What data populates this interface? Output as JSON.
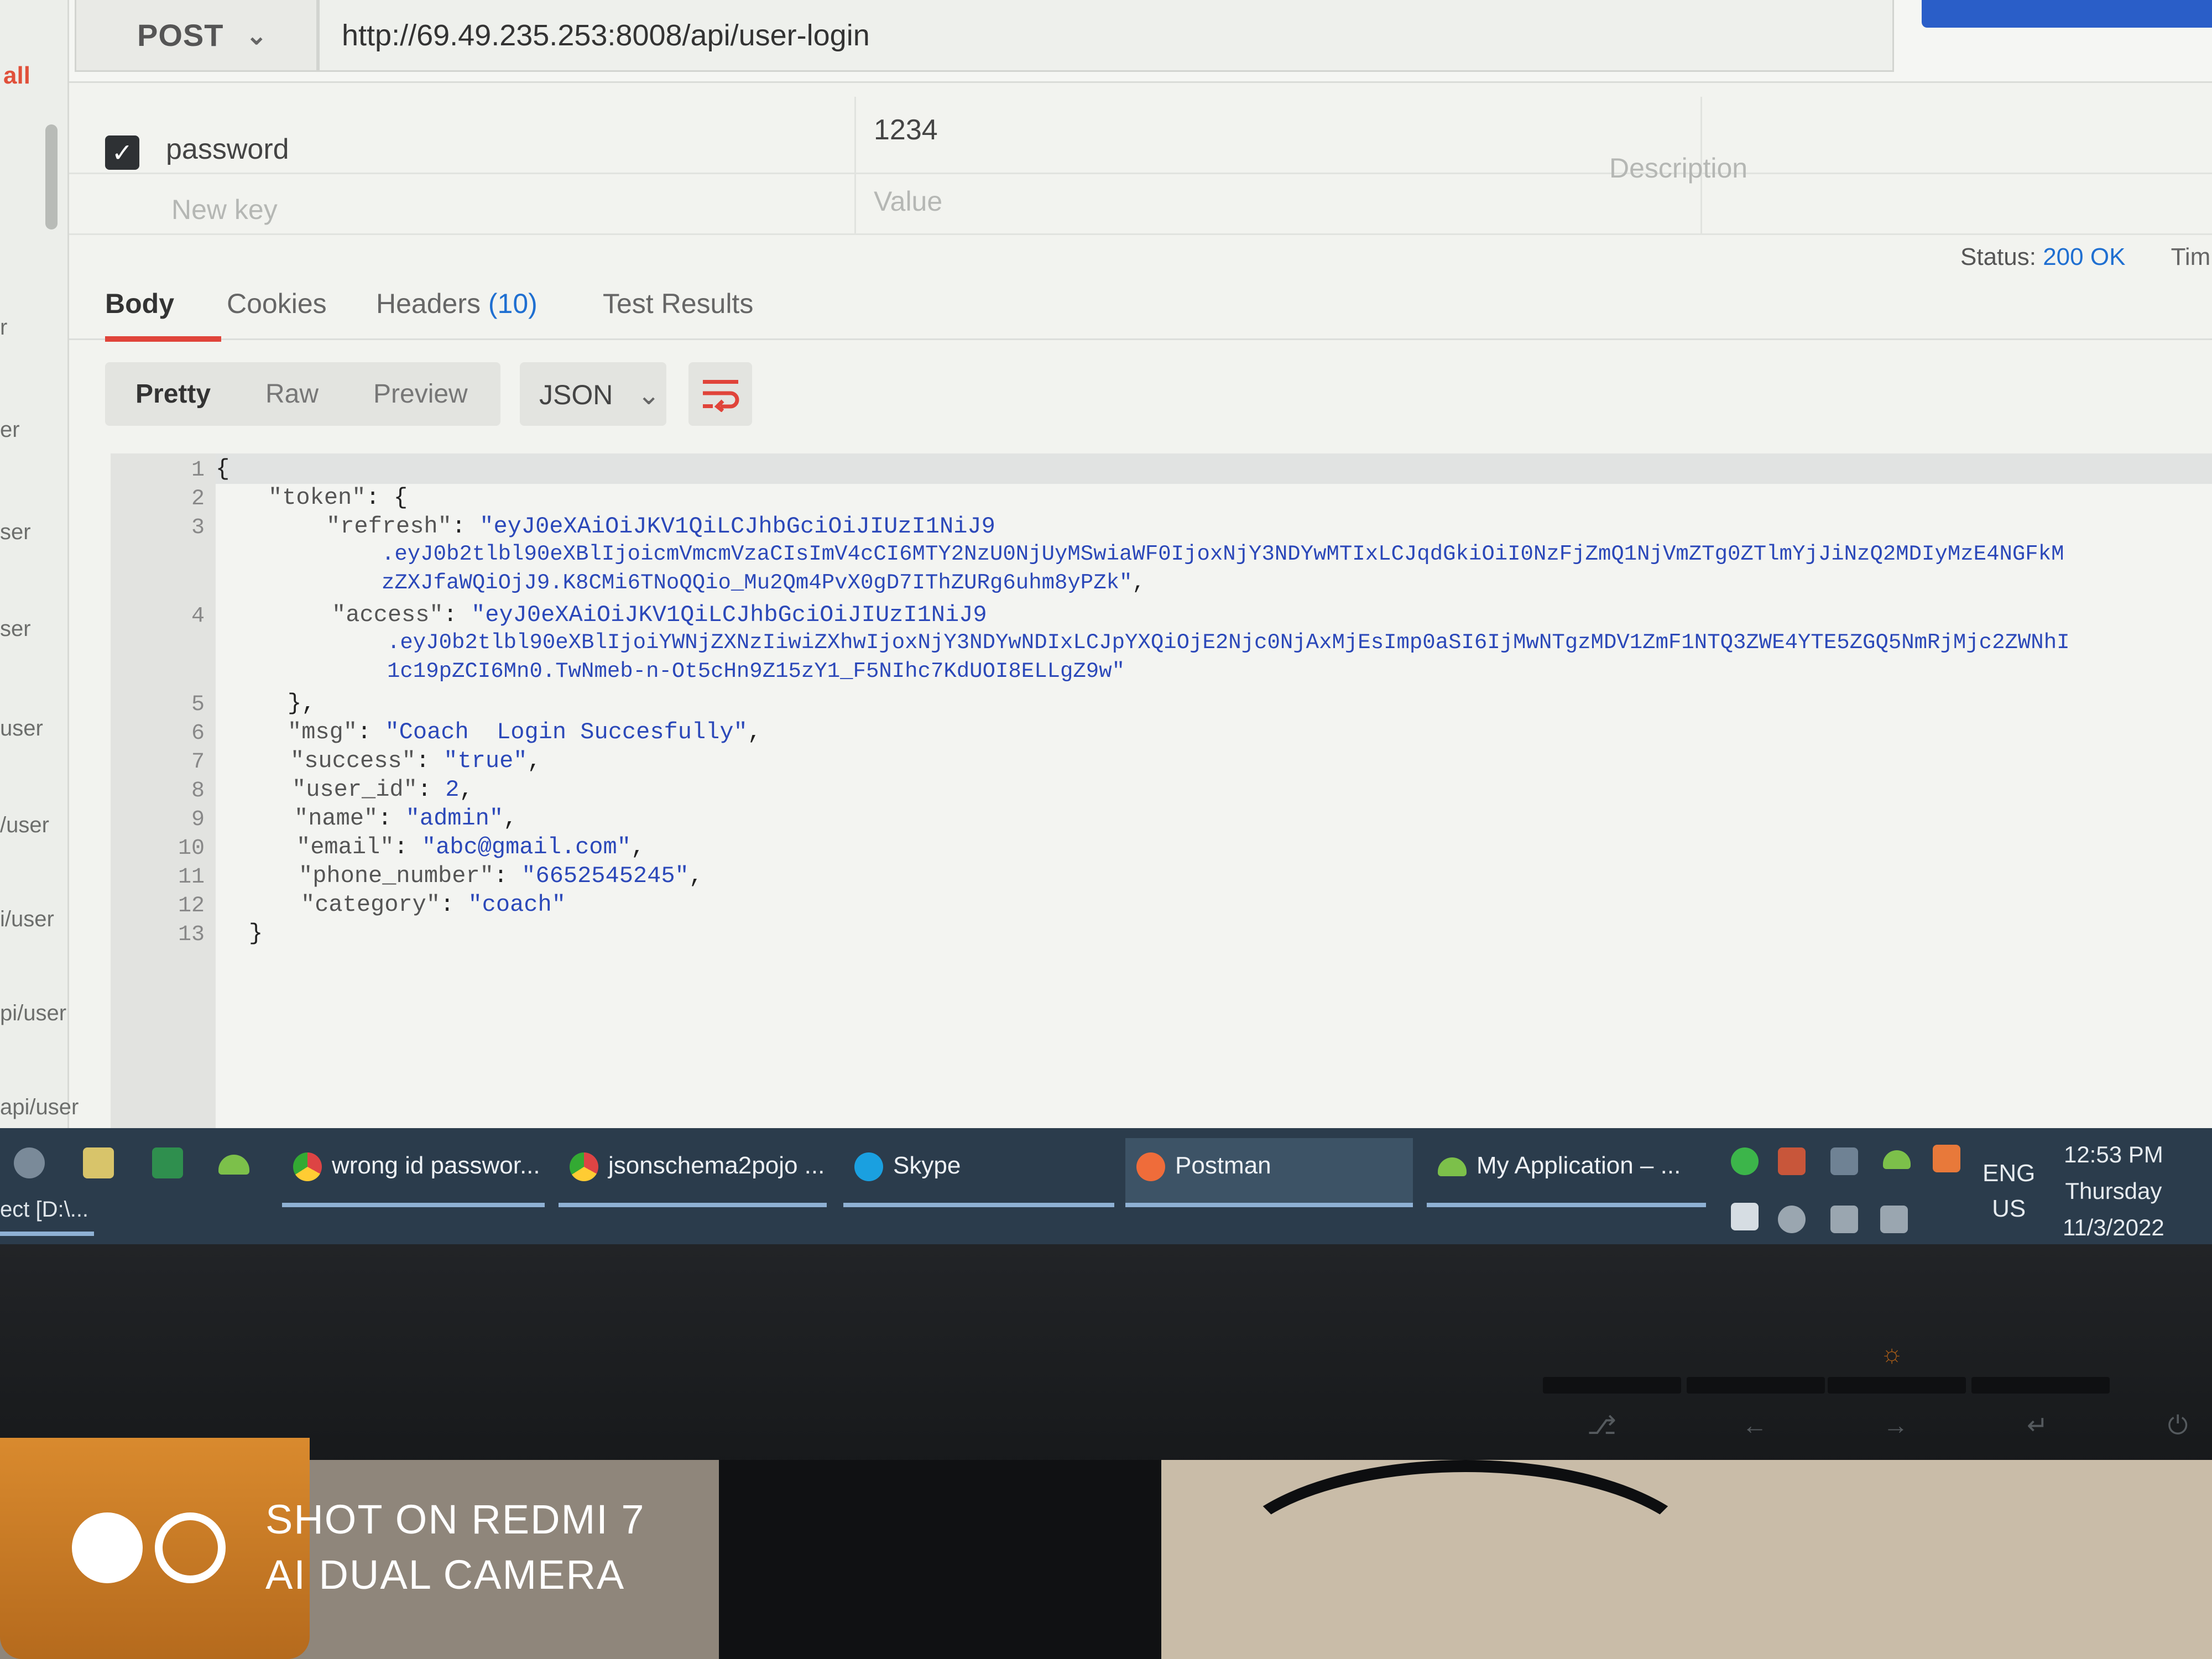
{
  "request": {
    "method": "POST",
    "url": "http://69.49.235.253:8008/api/user-login"
  },
  "sidebar": {
    "filter_label": "all",
    "history": [
      "r",
      "er",
      "ser",
      "ser",
      "user",
      "/user",
      "i/user",
      "pi/user",
      "api/user"
    ]
  },
  "params": {
    "rows": [
      {
        "checked": true,
        "key": "password",
        "value": "1234"
      }
    ],
    "new_row": {
      "key_placeholder": "New key",
      "value_placeholder": "Value",
      "description_placeholder": "Description"
    }
  },
  "status": {
    "label": "Status:",
    "value": "200 OK",
    "time_label": "Tim"
  },
  "response_tabs": {
    "body": "Body",
    "cookies": "Cookies",
    "headers": "Headers",
    "headers_count": "(10)",
    "tests": "Test Results"
  },
  "format": {
    "pretty": "Pretty",
    "raw": "Raw",
    "preview": "Preview",
    "language": "JSON"
  },
  "code": {
    "line_numbers": [
      "1",
      "2",
      "3",
      "4",
      "5",
      "6",
      "7",
      "8",
      "9",
      "10",
      "11",
      "12",
      "13"
    ],
    "l1": "{",
    "l2_key": "\"token\"",
    "l2_rest": ": {",
    "l3_key": "\"refresh\"",
    "l3_val_a": "\"eyJ0eXAiOiJKV1QiLCJhbGciOiJIUzI1NiJ9",
    "l3_val_b": ".eyJ0b2tlbl90eXBlIjoicmVmcmVzaCIsImV4cCI6MTY2NzU0NjUyMSwiaWF0IjoxNjY3NDYwMTIxLCJqdGkiOiI0NzFjZmQ1NjVmZTg0ZTlmYjJiNzQ2MDIyMzE4NGFkM",
    "l3_val_c": "zZXJfaWQiOjJ9.K8CMi6TNoQQio_Mu2Qm4PvX0gD7IThZURg6uhm8yPZk\"",
    "l4_key": "\"access\"",
    "l4_val_a": "\"eyJ0eXAiOiJKV1QiLCJhbGciOiJIUzI1NiJ9",
    "l4_val_b": ".eyJ0b2tlbl90eXBlIjoiYWNjZXNzIiwiZXhwIjoxNjY3NDYwNDIxLCJpYXQiOjE2Njc0NjAxMjEsImp0aSI6IjMwNTgzMDV1ZmF1NTQ3ZWE4YTE5ZGQ5NmRjMjc2ZWNhI",
    "l4_val_c": "1c19pZCI6Mn0.TwNmeb-n-Ot5cHn9Z15zY1_F5NIhc7KdUOI8ELLgZ9w\"",
    "l5": "},",
    "l6_key": "\"msg\"",
    "l6_val": "\"Coach  Login Succesfully\"",
    "l7_key": "\"success\"",
    "l7_val": "\"true\"",
    "l8_key": "\"user_id\"",
    "l8_val": "2",
    "l9_key": "\"name\"",
    "l9_val": "\"admin\"",
    "l10_key": "\"email\"",
    "l10_val": "\"abc@gmail.com\"",
    "l11_key": "\"phone_number\"",
    "l11_val": "\"6652545245\"",
    "l12_key": "\"category\"",
    "l12_val": "\"coach\"",
    "l13": "}"
  },
  "taskbar": {
    "apps": [
      {
        "label": "wrong id passwor...",
        "icon": "chrome-icon"
      },
      {
        "label": "jsonschema2pojo ...",
        "icon": "chrome-icon"
      },
      {
        "label": "Skype",
        "icon": "skype-icon"
      },
      {
        "label": "Postman",
        "icon": "postman-icon"
      },
      {
        "label": "My Application – ...",
        "icon": "android-studio-icon"
      }
    ],
    "sub_label": "ect [D:\\...",
    "lang_1": "ENG",
    "lang_2": "US",
    "time": "12:53 PM",
    "day": "Thursday",
    "date": "11/3/2022"
  },
  "watermark": {
    "line1": "SHOT ON REDMI 7",
    "line2": "AI DUAL CAMERA"
  },
  "colors": {
    "accent_red": "#e0443a",
    "status_blue": "#1f6fd1",
    "json_string": "#2b48b9",
    "taskbar": "#2b3c4c",
    "send_button": "#2a5ec8"
  }
}
